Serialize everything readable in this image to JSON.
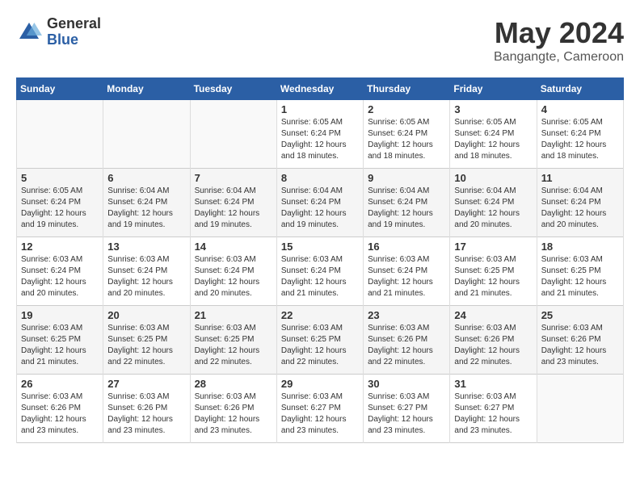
{
  "logo": {
    "general": "General",
    "blue": "Blue"
  },
  "title": "May 2024",
  "subtitle": "Bangangte, Cameroon",
  "days_header": [
    "Sunday",
    "Monday",
    "Tuesday",
    "Wednesday",
    "Thursday",
    "Friday",
    "Saturday"
  ],
  "weeks": [
    [
      {
        "num": "",
        "info": ""
      },
      {
        "num": "",
        "info": ""
      },
      {
        "num": "",
        "info": ""
      },
      {
        "num": "1",
        "info": "Sunrise: 6:05 AM\nSunset: 6:24 PM\nDaylight: 12 hours\nand 18 minutes."
      },
      {
        "num": "2",
        "info": "Sunrise: 6:05 AM\nSunset: 6:24 PM\nDaylight: 12 hours\nand 18 minutes."
      },
      {
        "num": "3",
        "info": "Sunrise: 6:05 AM\nSunset: 6:24 PM\nDaylight: 12 hours\nand 18 minutes."
      },
      {
        "num": "4",
        "info": "Sunrise: 6:05 AM\nSunset: 6:24 PM\nDaylight: 12 hours\nand 18 minutes."
      }
    ],
    [
      {
        "num": "5",
        "info": "Sunrise: 6:05 AM\nSunset: 6:24 PM\nDaylight: 12 hours\nand 19 minutes."
      },
      {
        "num": "6",
        "info": "Sunrise: 6:04 AM\nSunset: 6:24 PM\nDaylight: 12 hours\nand 19 minutes."
      },
      {
        "num": "7",
        "info": "Sunrise: 6:04 AM\nSunset: 6:24 PM\nDaylight: 12 hours\nand 19 minutes."
      },
      {
        "num": "8",
        "info": "Sunrise: 6:04 AM\nSunset: 6:24 PM\nDaylight: 12 hours\nand 19 minutes."
      },
      {
        "num": "9",
        "info": "Sunrise: 6:04 AM\nSunset: 6:24 PM\nDaylight: 12 hours\nand 19 minutes."
      },
      {
        "num": "10",
        "info": "Sunrise: 6:04 AM\nSunset: 6:24 PM\nDaylight: 12 hours\nand 20 minutes."
      },
      {
        "num": "11",
        "info": "Sunrise: 6:04 AM\nSunset: 6:24 PM\nDaylight: 12 hours\nand 20 minutes."
      }
    ],
    [
      {
        "num": "12",
        "info": "Sunrise: 6:03 AM\nSunset: 6:24 PM\nDaylight: 12 hours\nand 20 minutes."
      },
      {
        "num": "13",
        "info": "Sunrise: 6:03 AM\nSunset: 6:24 PM\nDaylight: 12 hours\nand 20 minutes."
      },
      {
        "num": "14",
        "info": "Sunrise: 6:03 AM\nSunset: 6:24 PM\nDaylight: 12 hours\nand 20 minutes."
      },
      {
        "num": "15",
        "info": "Sunrise: 6:03 AM\nSunset: 6:24 PM\nDaylight: 12 hours\nand 21 minutes."
      },
      {
        "num": "16",
        "info": "Sunrise: 6:03 AM\nSunset: 6:24 PM\nDaylight: 12 hours\nand 21 minutes."
      },
      {
        "num": "17",
        "info": "Sunrise: 6:03 AM\nSunset: 6:25 PM\nDaylight: 12 hours\nand 21 minutes."
      },
      {
        "num": "18",
        "info": "Sunrise: 6:03 AM\nSunset: 6:25 PM\nDaylight: 12 hours\nand 21 minutes."
      }
    ],
    [
      {
        "num": "19",
        "info": "Sunrise: 6:03 AM\nSunset: 6:25 PM\nDaylight: 12 hours\nand 21 minutes."
      },
      {
        "num": "20",
        "info": "Sunrise: 6:03 AM\nSunset: 6:25 PM\nDaylight: 12 hours\nand 22 minutes."
      },
      {
        "num": "21",
        "info": "Sunrise: 6:03 AM\nSunset: 6:25 PM\nDaylight: 12 hours\nand 22 minutes."
      },
      {
        "num": "22",
        "info": "Sunrise: 6:03 AM\nSunset: 6:25 PM\nDaylight: 12 hours\nand 22 minutes."
      },
      {
        "num": "23",
        "info": "Sunrise: 6:03 AM\nSunset: 6:26 PM\nDaylight: 12 hours\nand 22 minutes."
      },
      {
        "num": "24",
        "info": "Sunrise: 6:03 AM\nSunset: 6:26 PM\nDaylight: 12 hours\nand 22 minutes."
      },
      {
        "num": "25",
        "info": "Sunrise: 6:03 AM\nSunset: 6:26 PM\nDaylight: 12 hours\nand 23 minutes."
      }
    ],
    [
      {
        "num": "26",
        "info": "Sunrise: 6:03 AM\nSunset: 6:26 PM\nDaylight: 12 hours\nand 23 minutes."
      },
      {
        "num": "27",
        "info": "Sunrise: 6:03 AM\nSunset: 6:26 PM\nDaylight: 12 hours\nand 23 minutes."
      },
      {
        "num": "28",
        "info": "Sunrise: 6:03 AM\nSunset: 6:26 PM\nDaylight: 12 hours\nand 23 minutes."
      },
      {
        "num": "29",
        "info": "Sunrise: 6:03 AM\nSunset: 6:27 PM\nDaylight: 12 hours\nand 23 minutes."
      },
      {
        "num": "30",
        "info": "Sunrise: 6:03 AM\nSunset: 6:27 PM\nDaylight: 12 hours\nand 23 minutes."
      },
      {
        "num": "31",
        "info": "Sunrise: 6:03 AM\nSunset: 6:27 PM\nDaylight: 12 hours\nand 23 minutes."
      },
      {
        "num": "",
        "info": ""
      }
    ]
  ]
}
